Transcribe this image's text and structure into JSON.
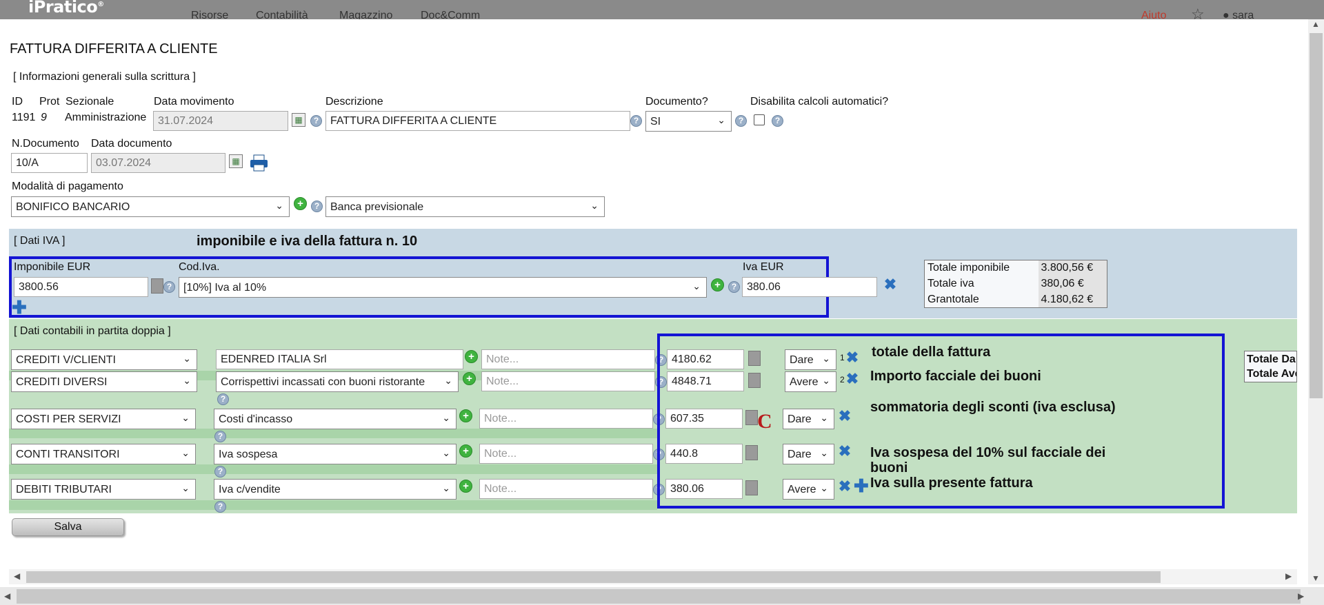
{
  "app": {
    "brand": "iPratico",
    "nav": [
      "Risorse",
      "Contabilità",
      "Magazzino",
      "Doc&Comm"
    ],
    "help": "Aiuto",
    "user": "sara"
  },
  "page_title": "FATTURA DIFFERITA A CLIENTE",
  "general": {
    "section": "[ Informazioni generali sulla scrittura ]",
    "id_label": "ID",
    "id_value": "1191",
    "prot_label": "Prot",
    "prot_value": "9",
    "sezionale_label": "Sezionale",
    "sezionale_value": "Amministrazione",
    "data_mov_label": "Data movimento",
    "data_mov_value": "31.07.2024",
    "descr_label": "Descrizione",
    "descr_value": "FATTURA DIFFERITA A CLIENTE",
    "documento_label": "Documento?",
    "documento_value": "SI",
    "disabilita_label": "Disabilita calcoli automatici?",
    "ndoc_label": "N.Documento",
    "ndoc_value": "10/A",
    "data_doc_label": "Data documento",
    "data_doc_value": "03.07.2024",
    "pagamento_label": "Modalità di pagamento",
    "pagamento_value": "BONIFICO BANCARIO",
    "banca_value": "Banca previsionale"
  },
  "iva": {
    "section": "[ Dati IVA ]",
    "annotation": "imponibile e iva della fattura n. 10",
    "imponibile_label": "Imponibile EUR",
    "imponibile_value": "3800.56",
    "codiva_label": "Cod.Iva.",
    "codiva_value": "[10%] Iva al 10%",
    "ivaeur_label": "Iva EUR",
    "ivaeur_value": "380.06",
    "totals": [
      {
        "label": "Totale imponibile",
        "value": "3.800,56 €"
      },
      {
        "label": "Totale iva",
        "value": "380,06 €"
      },
      {
        "label": "Grantotale",
        "value": "4.180,62 €"
      }
    ]
  },
  "contabili": {
    "section": "[ Dati contabili in partita doppia ]",
    "note_placeholder": "Note...",
    "side_totals": [
      "Totale Da",
      "Totale Ave"
    ],
    "rows": [
      {
        "conto": "CREDITI V/CLIENTI",
        "sotto": "EDENRED ITALIA Srl",
        "amount": "4180.62",
        "dc": "Dare",
        "num": "1",
        "annotation": "totale della fattura"
      },
      {
        "conto": "CREDITI DIVERSI",
        "sotto": "Corrispettivi incassati con buoni ristorante",
        "amount": "4848.71",
        "dc": "Avere",
        "num": "2",
        "annotation": "Importo facciale dei buoni"
      },
      {
        "conto": "COSTI PER SERVIZI",
        "sotto": "Costi d'incasso",
        "amount": "607.35",
        "dc": "Dare",
        "num": "",
        "annotation": "sommatoria degli sconti (iva esclusa)"
      },
      {
        "conto": "CONTI TRANSITORI",
        "sotto": "Iva sospesa",
        "amount": "440.8",
        "dc": "Dare",
        "num": "",
        "annotation": "Iva sospesa del 10% sul facciale dei buoni"
      },
      {
        "conto": "DEBITI TRIBUTARI",
        "sotto": "Iva c/vendite",
        "amount": "380.06",
        "dc": "Avere",
        "num": "",
        "annotation": "Iva sulla presente fattura"
      }
    ],
    "red_mark": "C"
  },
  "save_label": "Salva",
  "icons": {
    "help": "help-icon",
    "add": "add-circle-icon",
    "remove": "remove-x-icon",
    "calendar": "calendar-icon",
    "print": "printer-icon",
    "calculator": "calculator-icon",
    "add_row": "add-row-cross-icon"
  },
  "colors": {
    "iva_bg": "#c8d8e4",
    "cont_bg": "#c3e0c3",
    "annotation_box": "#1414d4",
    "remove_icon": "#2a6fbd",
    "add_icon": "#3fb33f"
  }
}
